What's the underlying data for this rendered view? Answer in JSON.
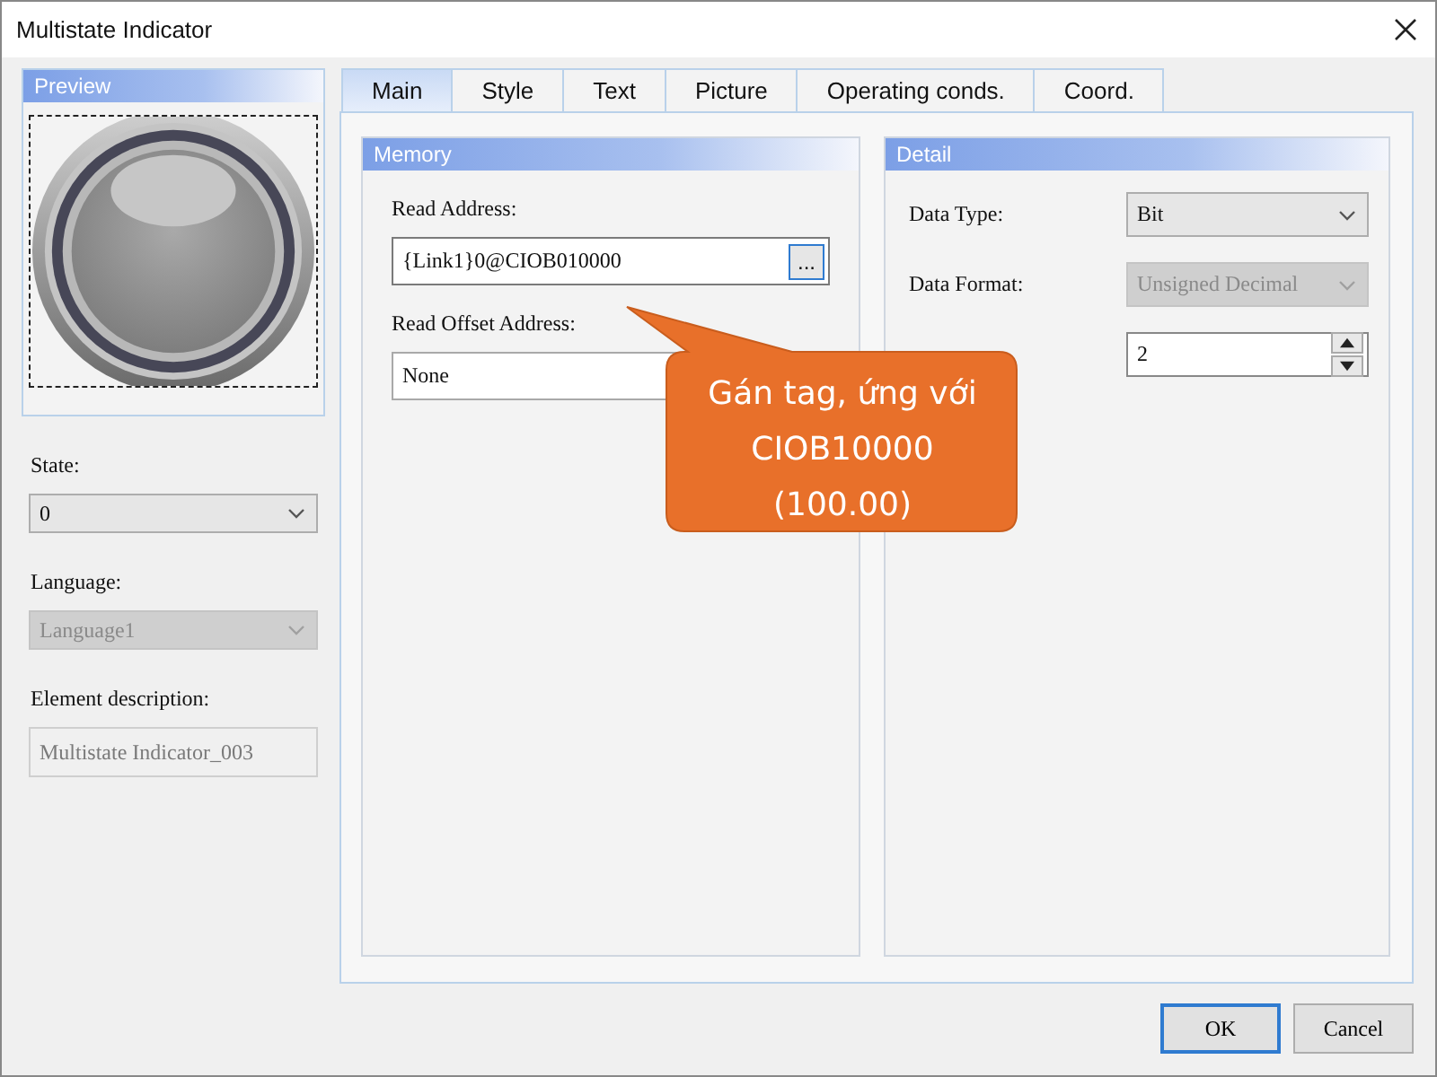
{
  "window": {
    "title": "Multistate Indicator"
  },
  "preview": {
    "title": "Preview"
  },
  "left_fields": [
    {
      "label": "State:",
      "value": "0",
      "kind": "select",
      "disabled": false
    },
    {
      "label": "Language:",
      "value": "Language1",
      "kind": "select",
      "disabled": true
    },
    {
      "label": "Element description:",
      "value": "Multistate Indicator_003",
      "kind": "text",
      "disabled": true
    }
  ],
  "tabs": [
    {
      "label": "Main",
      "selected": true
    },
    {
      "label": "Style",
      "selected": false
    },
    {
      "label": "Text",
      "selected": false
    },
    {
      "label": "Picture",
      "selected": false
    },
    {
      "label": "Operating conds.",
      "selected": false
    },
    {
      "label": "Coord.",
      "selected": false
    }
  ],
  "memory": {
    "title": "Memory",
    "fields": [
      {
        "label": "Read Address:",
        "value": "{Link1}0@CIOB010000",
        "kind": "browse",
        "button": "...",
        "focused": true
      },
      {
        "label": "Read Offset Address:",
        "value": "None",
        "kind": "text",
        "focused": false
      }
    ]
  },
  "detail": {
    "title": "Detail",
    "fields": [
      {
        "label": "Data Type:",
        "value": "Bit",
        "kind": "select",
        "disabled": false
      },
      {
        "label": "Data Format:",
        "value": "Unsigned Decimal",
        "kind": "select",
        "disabled": true
      },
      {
        "value": "2",
        "kind": "spin",
        "disabled": false
      }
    ]
  },
  "callout": {
    "text": "Gán tag, ứng với\nCIOB10000\n(100.00)"
  },
  "buttons": [
    {
      "label": "OK",
      "default": true
    },
    {
      "label": "Cancel",
      "default": false
    }
  ]
}
